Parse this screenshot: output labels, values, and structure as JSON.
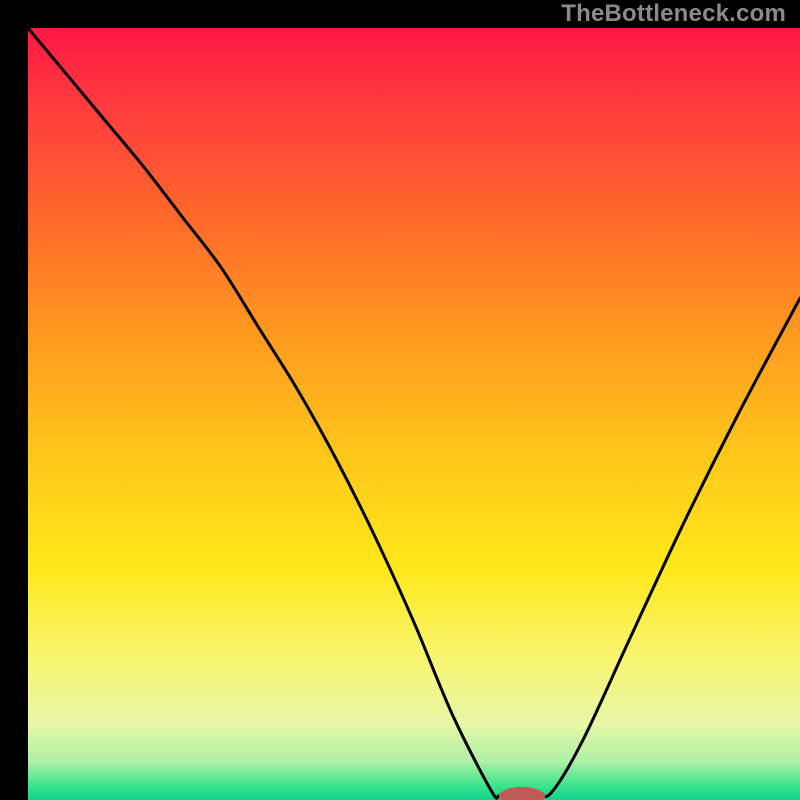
{
  "watermark": "TheBottleneck.com",
  "chart_data": {
    "type": "line",
    "title": "",
    "xlabel": "",
    "ylabel": "",
    "xlim": [
      0,
      100
    ],
    "ylim": [
      0,
      100
    ],
    "background_gradient_stops": [
      {
        "offset": 0.0,
        "color": "#ff1744"
      },
      {
        "offset": 0.1,
        "color": "#ff3b3f"
      },
      {
        "offset": 0.25,
        "color": "#ff6a2a"
      },
      {
        "offset": 0.4,
        "color": "#ff9a1f"
      },
      {
        "offset": 0.55,
        "color": "#ffc61a"
      },
      {
        "offset": 0.7,
        "color": "#ffe81a"
      },
      {
        "offset": 0.82,
        "color": "#f8f673"
      },
      {
        "offset": 0.9,
        "color": "#e8f7a6"
      },
      {
        "offset": 0.95,
        "color": "#aef0a6"
      },
      {
        "offset": 0.985,
        "color": "#2fe28a"
      },
      {
        "offset": 1.0,
        "color": "#12d18f"
      }
    ],
    "series": [
      {
        "name": "bottleneck-curve",
        "x": [
          0,
          5,
          10,
          15,
          20,
          25,
          30,
          35,
          40,
          45,
          50,
          55,
          60,
          61,
          62,
          66,
          68,
          72,
          78,
          85,
          92,
          100
        ],
        "values": [
          100,
          94,
          88,
          82,
          75.5,
          69,
          61,
          53,
          44,
          34,
          23,
          11,
          1.2,
          0.5,
          0.5,
          0.5,
          1.2,
          8,
          21,
          36,
          50,
          65
        ]
      }
    ],
    "marker": {
      "name": "optimal-point",
      "x": 64,
      "y": 0.5,
      "rx_pct": 3.0,
      "ry_pct": 1.2,
      "color": "#c05a55"
    }
  }
}
